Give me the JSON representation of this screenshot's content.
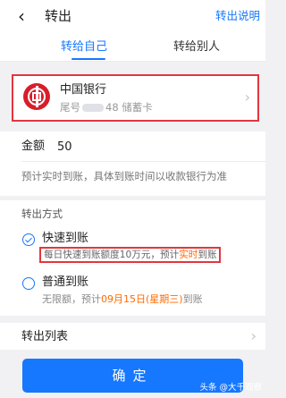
{
  "header": {
    "back_glyph": "‹",
    "title": "转出",
    "help": "转出说明"
  },
  "tabs": [
    {
      "label": "转给自己",
      "active": true
    },
    {
      "label": "转给别人",
      "active": false
    }
  ],
  "bank": {
    "name": "中国银行",
    "tail_prefix": "尾号",
    "tail_suffix": "48 储蓄卡",
    "logo_icon": "bank-of-china-logo"
  },
  "amount": {
    "label": "金额",
    "value": "50",
    "hint": "预计实时到账，具体到账时间以收款银行为准"
  },
  "method": {
    "title": "转出方式",
    "fast": {
      "label": "快速到账",
      "desc_pre": "每日快速到账额度10万元，预计",
      "desc_hl": "实时",
      "desc_post": "到账",
      "selected": true
    },
    "normal": {
      "label": "普通到账",
      "desc_pre": "无限额，预计",
      "desc_date": "09月15日(星期三)",
      "desc_post": "到账",
      "selected": false
    }
  },
  "list": {
    "label": "转出列表"
  },
  "confirm": {
    "label": "确定"
  },
  "watermark": "头条 @大千观察",
  "colors": {
    "accent": "#1677ff",
    "highlight": "#ff6a00",
    "annotation_box": "#e2363d",
    "bank_red": "#d81e2a"
  }
}
